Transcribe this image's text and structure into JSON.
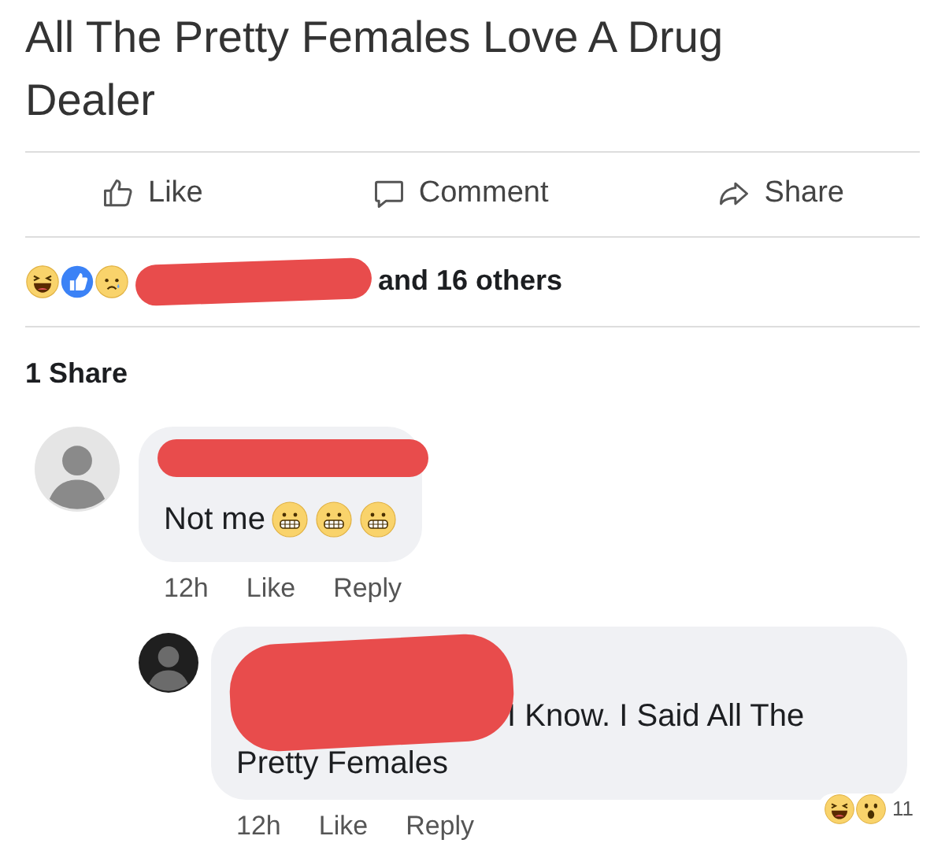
{
  "post": {
    "title": "All The Pretty Females Love A Drug Dealer",
    "actions": [
      {
        "kind": "like",
        "label": "Like"
      },
      {
        "kind": "comment",
        "label": "Comment"
      },
      {
        "kind": "share",
        "label": "Share"
      }
    ],
    "reactions": [
      {
        "kind": "haha"
      },
      {
        "kind": "like"
      },
      {
        "kind": "sad"
      }
    ],
    "reactions_text": "and 16 others",
    "shares": "1 Share"
  },
  "comments": [
    {
      "avatar": {
        "kind": "light"
      },
      "text": "Not me",
      "emojis": [
        {
          "kind": "grimace"
        },
        {
          "kind": "grimace"
        },
        {
          "kind": "grimace"
        }
      ],
      "time": "12h",
      "like": "Like",
      "reply": "Reply",
      "reply_level": false
    },
    {
      "avatar": {
        "kind": "dark"
      },
      "text": "I Know. I Said All The Pretty Females",
      "time": "12h",
      "like": "Like",
      "reply": "Reply",
      "reply_level": true,
      "reactions": [
        {
          "kind": "haha"
        },
        {
          "kind": "wow"
        }
      ],
      "reaction_count": "11"
    }
  ]
}
